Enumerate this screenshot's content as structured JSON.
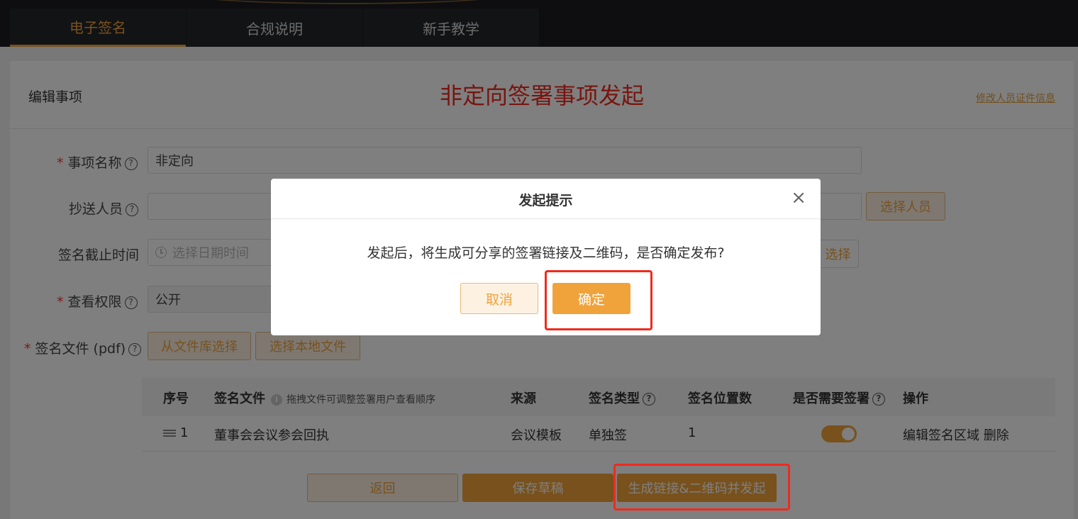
{
  "nav": {
    "tabs": [
      {
        "label": "电子签名",
        "active": true
      },
      {
        "label": "合规说明",
        "active": false
      },
      {
        "label": "新手教学",
        "active": false
      }
    ]
  },
  "header": {
    "edit_label": "编辑事项",
    "title": "非定向签署事项发起",
    "modify_link": "修改人员证件信息"
  },
  "form": {
    "item_name": {
      "label": "事项名称",
      "value": "非定向",
      "required": true
    },
    "cc": {
      "label": "抄送人员",
      "button": "选择人员"
    },
    "deadline": {
      "label": "签名截止时间",
      "placeholder": "选择日期时间",
      "button": "选择"
    },
    "view_perm": {
      "label": "查看权限",
      "value": "公开",
      "required": true
    },
    "sign_file": {
      "label": "签名文件 (pdf)",
      "required": true,
      "btn_library": "从文件库选择",
      "btn_local": "选择本地文件"
    }
  },
  "table": {
    "headers": {
      "index": "序号",
      "file": "签名文件",
      "file_hint": "拖拽文件可调整签署用户查看顺序",
      "source": "来源",
      "sign_type": "签名类型",
      "positions": "签名位置数",
      "need_seal": "是否需要签署",
      "ops": "操作"
    },
    "rows": [
      {
        "index": "1",
        "file": "董事会会议参会回执",
        "source": "会议模板",
        "sign_type": "单独签",
        "positions": "1",
        "need_seal": true,
        "op_edit": "编辑签名区域",
        "op_delete": "删除"
      }
    ]
  },
  "actions": {
    "back": "返回",
    "save_draft": "保存草稿",
    "generate": "生成链接&二维码并发起"
  },
  "dialog": {
    "title": "发起提示",
    "message": "发起后，将生成可分享的签署链接及二维码，是否确定发布?",
    "cancel": "取消",
    "confirm": "确定"
  },
  "colors": {
    "accent": "#f0a33a",
    "title_red": "#f02a1e",
    "nav_bg": "#1c1d21"
  }
}
